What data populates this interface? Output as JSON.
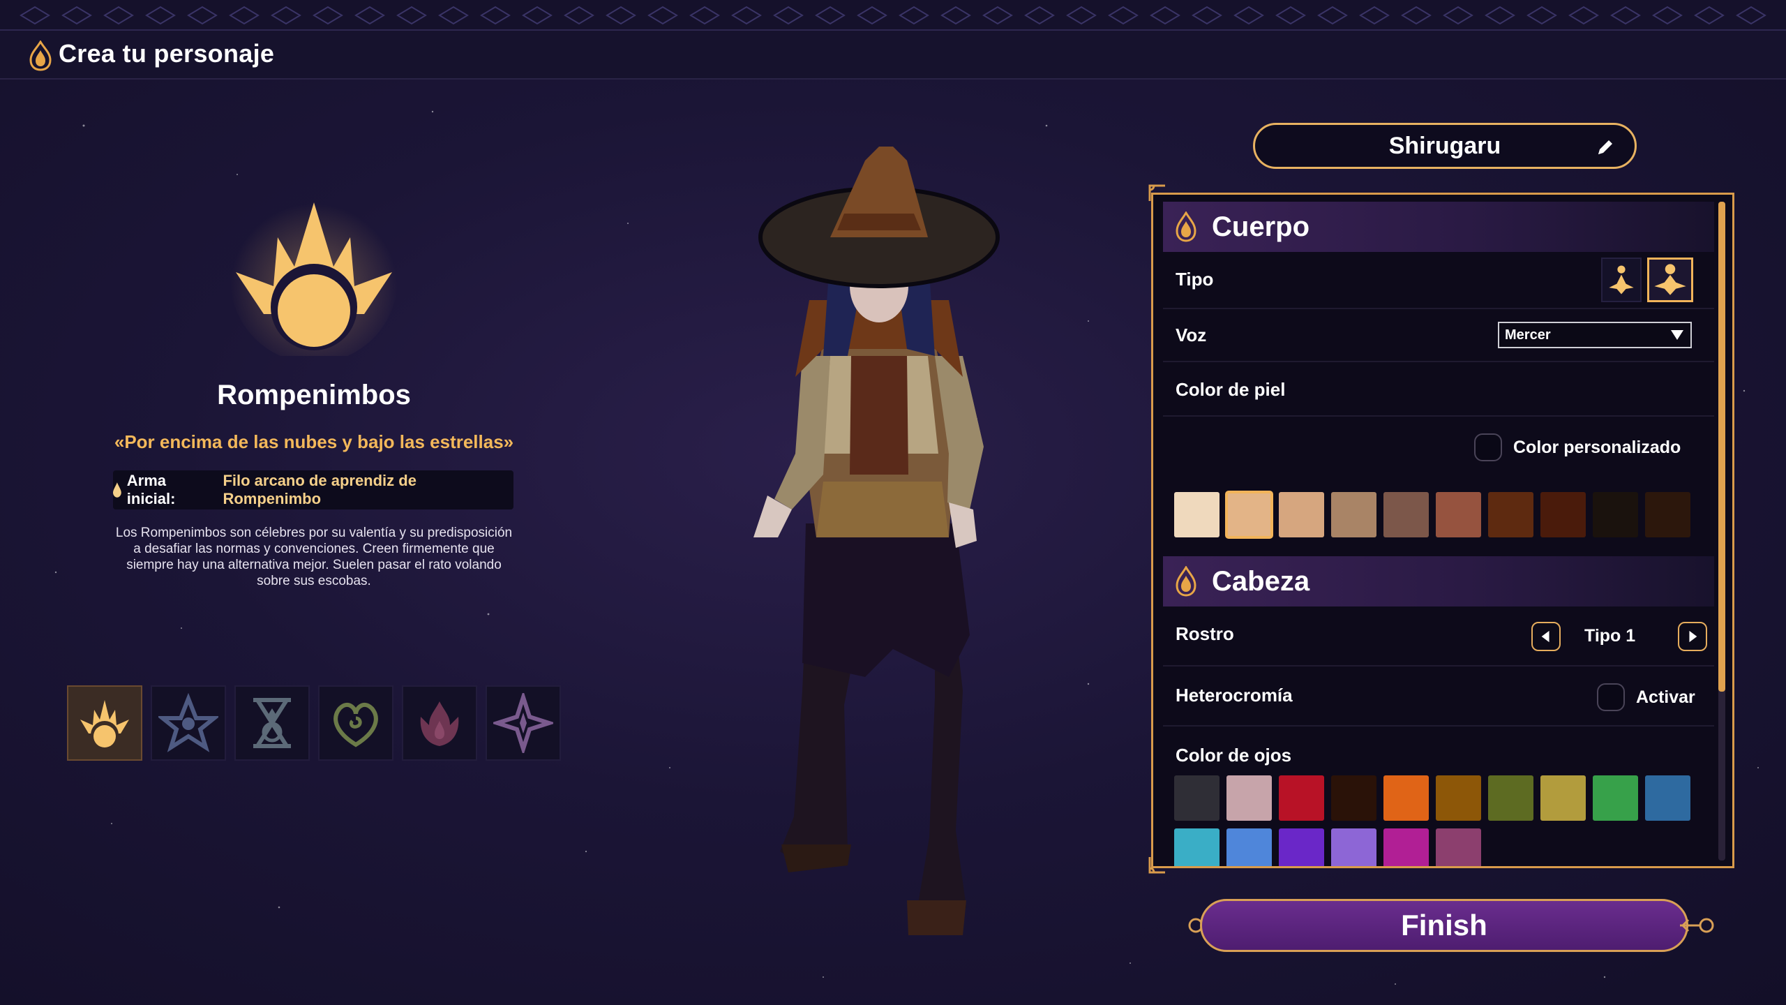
{
  "header": {
    "title": "Crea tu personaje"
  },
  "class_info": {
    "name": "Rompenimbos",
    "motto": "«Por encima de las nubes y bajo las estrellas»",
    "weapon_label": "Arma inicial:",
    "weapon_value": "Filo arcano de aprendiz de Rompenimbo",
    "description": "Los Rompenimbos son célebres por su valentía y su predisposición a desafiar las normas y convenciones. Creen firmemente que siempre hay una alternativa mejor. Suelen pasar el rato volando sobre sus escobas."
  },
  "class_icons": [
    {
      "name": "sun-crown-icon",
      "active": true
    },
    {
      "name": "star-figure-icon",
      "active": false
    },
    {
      "name": "hourglass-eye-icon",
      "active": false
    },
    {
      "name": "spiral-heart-icon",
      "active": false
    },
    {
      "name": "lotus-flame-icon",
      "active": false
    },
    {
      "name": "four-point-star-icon",
      "active": false
    }
  ],
  "character_name": "Shirugaru",
  "panel": {
    "body_section": {
      "title": "Cuerpo",
      "type_label": "Tipo",
      "voice_label": "Voz",
      "voice_value": "Mercer",
      "skin_label": "Color de piel",
      "custom_color_label": "Color personalizado",
      "skin_colors": [
        "#efd9bd",
        "#e3b487",
        "#d6a67f",
        "#a98466",
        "#7c574a",
        "#96533f",
        "#5e2a10",
        "#4a1b0b",
        "#1a120d",
        "#2c170c"
      ],
      "selected_skin_index": 1
    },
    "head_section": {
      "title": "Cabeza",
      "face_label": "Rostro",
      "face_value": "Tipo 1",
      "heterochromia_label": "Heterocromía",
      "heterochromia_toggle": "Activar",
      "eye_color_label": "Color de ojos",
      "eye_colors_row1": [
        "#2f2e36",
        "#c7a4aa",
        "#b81226",
        "#2a1208",
        "#e06417",
        "#8d5708",
        "#5d6b22",
        "#b29c3d",
        "#37a14a",
        "#2e6aa0"
      ],
      "eye_colors_row2": [
        "#3aaec6",
        "#4f86da",
        "#6a27c8",
        "#8d66d6",
        "#b11f95",
        "#8c3f6e"
      ]
    }
  },
  "finish_label": "Finish",
  "colors": {
    "accent": "#e8b261",
    "panel_bg": "#0d0a1a",
    "finish_bg": "#5a2380"
  }
}
